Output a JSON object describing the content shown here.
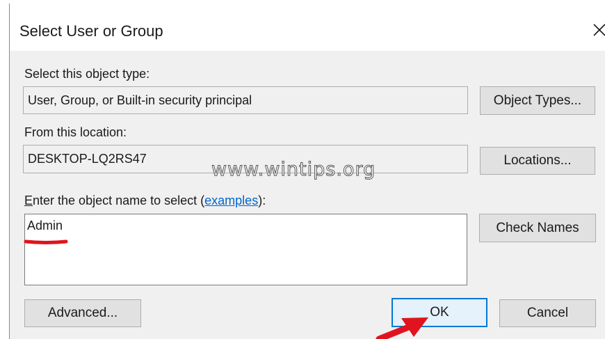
{
  "dialog": {
    "title": "Select User or Group",
    "close_icon": "close-icon"
  },
  "object_type": {
    "label": "Select this object type:",
    "value": "User, Group, or Built-in security principal",
    "button": "Object Types..."
  },
  "location": {
    "label": "From this location:",
    "value": "DESKTOP-LQ2RS47",
    "button": "Locations..."
  },
  "object_name": {
    "label_prefix_underlined": "E",
    "label_main": "nter the object name to select (",
    "link": "examples",
    "label_suffix": "):",
    "value": "Admin",
    "check_button": "Check Names"
  },
  "footer": {
    "advanced_button": "Advanced...",
    "ok_button": "OK",
    "cancel_button": "Cancel"
  },
  "watermark": "www.wintips.org",
  "colors": {
    "annotation": "#e0141e",
    "default_button_border": "#0078d7",
    "link": "#0066cc"
  }
}
